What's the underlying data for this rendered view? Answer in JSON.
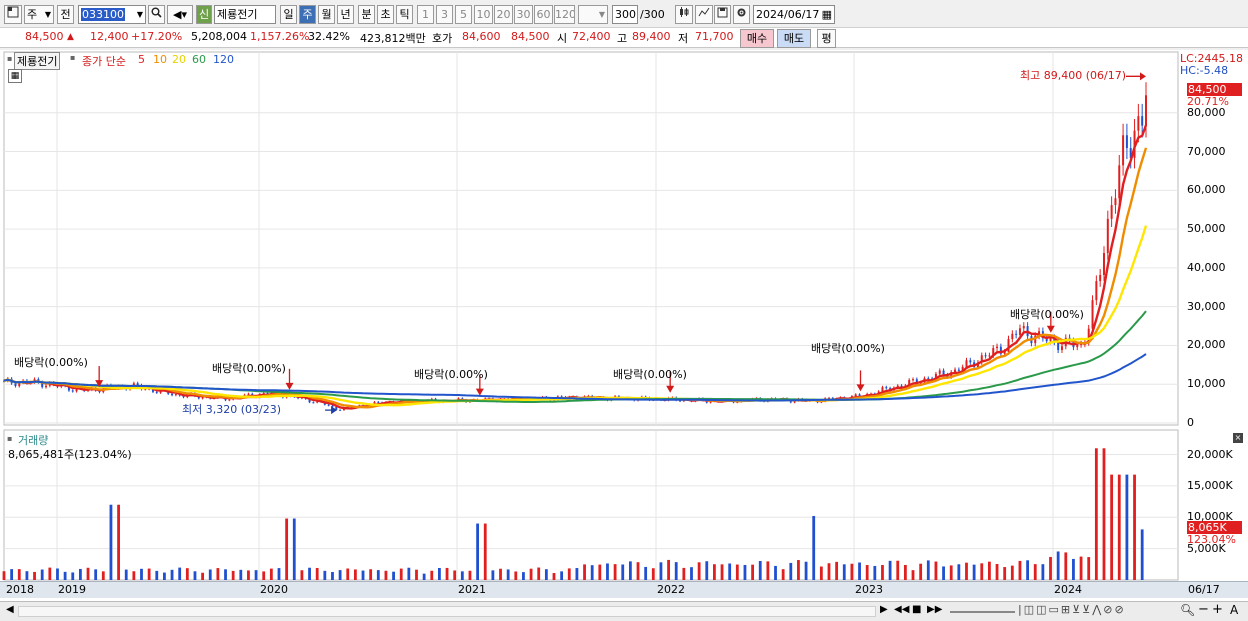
{
  "toolbar": {
    "period": "주",
    "prev_label": "전",
    "code": "033100",
    "new_badge": "신",
    "stock_name": "제룡전기",
    "tabs": [
      "일",
      "주",
      "월",
      "년",
      "분",
      "초",
      "틱"
    ],
    "active_tab": "주",
    "intervals": [
      "1",
      "3",
      "5",
      "10",
      "20",
      "30",
      "60",
      "120"
    ],
    "count": "300",
    "count_total": "/300",
    "date": "2024/06/17"
  },
  "info": {
    "price": "84,500",
    "change": "12,400",
    "change_pct": "+17.20%",
    "volume": "5,208,004",
    "volume_pct": "1,157.26%",
    "turnover_rate": "32.42%",
    "amount": "423,812백만",
    "quote_label": "호가",
    "bid": "84,600",
    "ask": "84,500",
    "open_label": "시",
    "open": "72,400",
    "high_label": "고",
    "high": "89,400",
    "low_label": "저",
    "low": "71,700",
    "buy_label": "매수",
    "sell_label": "매도",
    "flat_label": "평"
  },
  "legend": {
    "name": "제룡전기",
    "series_label": "종가 단순",
    "ma": [
      "5",
      "10",
      "20",
      "60",
      "120"
    ],
    "ma_colors": [
      "#e02020",
      "#f08c00",
      "#ffe600",
      "#2a9a4a",
      "#2255cc"
    ]
  },
  "price_panel": {
    "lc": "LC:2445.18",
    "hc": "HC:-5.48",
    "last_price": "84,500",
    "last_pct": "20.71%",
    "high_note": "최고 89,400 (06/17)",
    "low_note": "최저 3,320 (03/23)",
    "dividend_label": "배당락(0.00%)",
    "y_ticks": [
      "80,000",
      "70,000",
      "60,000",
      "50,000",
      "40,000",
      "30,000",
      "20,000",
      "10,000",
      "0"
    ]
  },
  "volume_panel": {
    "title": "거래량",
    "value": "8,065,481주(123.04%)",
    "last_volume": "8,065K",
    "last_pct": "123.04%",
    "y_ticks": [
      "20,000K",
      "15,000K",
      "10,000K",
      "5,000K"
    ]
  },
  "x_axis": {
    "years": [
      "2018",
      "2019",
      "2020",
      "2021",
      "2022",
      "2023",
      "2024"
    ],
    "last_date": "06/17"
  },
  "chart_data": {
    "type": "candlestick",
    "title": "제룡전기",
    "interval": "weekly",
    "x": [
      "2018-08",
      "2018-11",
      "2019-02",
      "2019-05",
      "2019-08",
      "2019-11",
      "2020-02",
      "2020-03",
      "2020-06",
      "2020-09",
      "2020-12",
      "2021-03",
      "2021-06",
      "2021-09",
      "2021-12",
      "2022-03",
      "2022-06",
      "2022-09",
      "2022-12",
      "2023-03",
      "2023-06",
      "2023-09",
      "2023-10",
      "2023-12",
      "2024-02",
      "2024-03",
      "2024-04",
      "2024-05",
      "2024-06"
    ],
    "close": [
      10500,
      8400,
      9600,
      7200,
      6300,
      7800,
      5200,
      3500,
      5400,
      5700,
      5900,
      6200,
      6600,
      6300,
      6100,
      5600,
      6100,
      5700,
      6900,
      10200,
      13500,
      19500,
      24000,
      21000,
      19800,
      36000,
      62000,
      72000,
      84500
    ],
    "ylim": [
      0,
      90000
    ],
    "high": {
      "value": 89400,
      "date": "06/17"
    },
    "low": {
      "value": 3320,
      "date": "03/23"
    },
    "ma_periods": [
      5,
      10,
      20,
      60,
      120
    ],
    "ma_end_values": [
      71000,
      68000,
      50000,
      30500,
      19800
    ],
    "dividend_ex_dates": [
      "2018-12",
      "2019-12",
      "2020-12",
      "2021-12",
      "2022-12",
      "2023-12"
    ],
    "volume_unit": "K",
    "volume_spikes": [
      {
        "x": "2019-01",
        "value": 12000
      },
      {
        "x": "2019-12",
        "value": 9800
      },
      {
        "x": "2020-12",
        "value": 9000
      },
      {
        "x": "2022-09",
        "value": 10200
      },
      {
        "x": "2024-03",
        "value": 21000
      },
      {
        "x": "2024-04",
        "value": 16800
      },
      {
        "x": "2024-05",
        "value": 16800
      }
    ],
    "last_volume": 8065,
    "ylim_volume": [
      0,
      22000
    ]
  }
}
